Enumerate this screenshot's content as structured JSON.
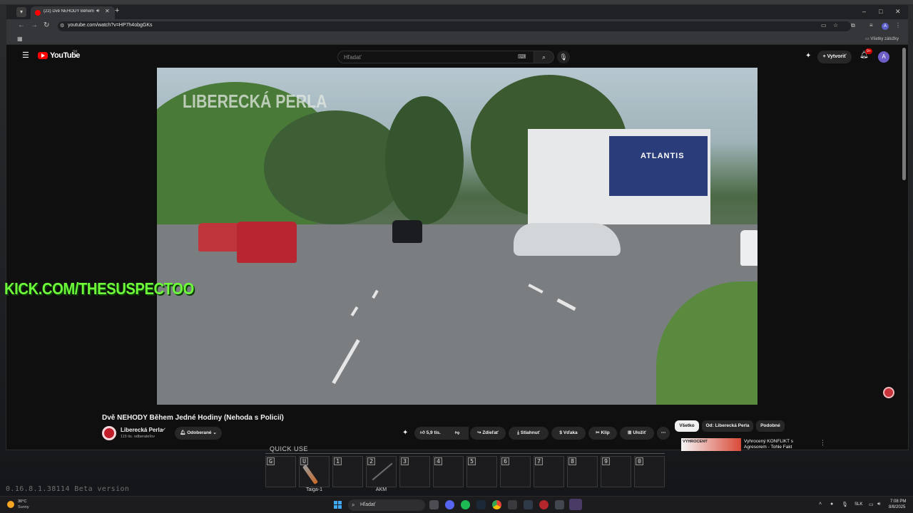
{
  "browser": {
    "tab_title": "(22) Dvě NEHODY Během J",
    "url": "youtube.com/watch?v=HP7h4obgGKs",
    "bookmarks_all": "Všetky záložky",
    "win_minimize": "–",
    "win_maximize": "□",
    "win_close": "✕",
    "new_tab": "+",
    "profile_letter": "A"
  },
  "youtube": {
    "logo_text": "YouTube",
    "country_code": "SK",
    "search_placeholder": "Hľadať",
    "create_label": "Vytvoriť",
    "notif_count": "9+",
    "avatar_letter": "A"
  },
  "video": {
    "watermark": "LIBERECKÁ PERLA",
    "billboard": "ATLANTIS",
    "title": "Dvě NEHODY Během Jedné Hodiny (Nehoda s Policií)",
    "channel": "Liberecká Perla",
    "subscribers": "115 tis. odberateľov",
    "subscribed_label": "Odoberané",
    "likes": "5,9 tis.",
    "share": "Zdieľať",
    "download": "Stiahnuť",
    "thanks": "Vďaka",
    "clip": "Klip",
    "save": "Uložiť"
  },
  "overlay": {
    "kick": "KICK.COM/THESUSPECTOO"
  },
  "related": {
    "chips": [
      "Všetko",
      "Od: Liberecká Perla",
      "Podobné"
    ],
    "item_thumb_text": "VYHROCENÝ",
    "item_title": "Vyhrocený KONFLIKT s Agresorem - Tohle Fakt"
  },
  "game": {
    "quick_use_label": "QUICK USE",
    "slots": [
      {
        "key": "G",
        "name": ""
      },
      {
        "key": "U",
        "name": "Taiga-1"
      },
      {
        "key": "1",
        "name": ""
      },
      {
        "key": "2",
        "name": "AKM"
      },
      {
        "key": "3",
        "name": ""
      },
      {
        "key": "4",
        "name": ""
      },
      {
        "key": "5",
        "name": ""
      },
      {
        "key": "6",
        "name": ""
      },
      {
        "key": "7",
        "name": ""
      },
      {
        "key": "8",
        "name": ""
      },
      {
        "key": "9",
        "name": ""
      },
      {
        "key": "0",
        "name": ""
      }
    ],
    "version": "0.16.8.1.38114 Beta version"
  },
  "taskbar": {
    "temperature": "30°C",
    "weather": "Sunny",
    "search_placeholder": "Hľadať",
    "language": "SLK",
    "time": "7:08 PM",
    "date": "8/8/2025"
  },
  "colors": {
    "youtube_red": "#ff0000",
    "kick_green": "#6efc3a",
    "record_red": "#c8343b"
  }
}
